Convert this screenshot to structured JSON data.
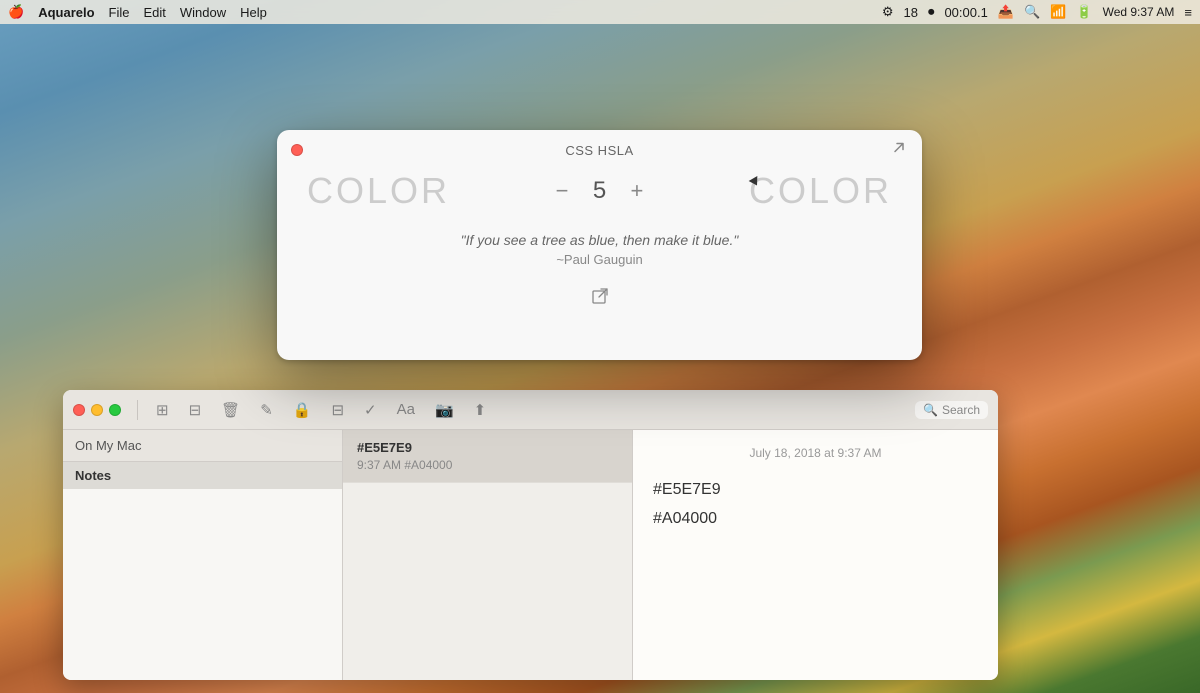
{
  "menubar": {
    "apple": "🍎",
    "app_name": "Aquarelo",
    "menus": [
      "File",
      "Edit",
      "Window",
      "Help"
    ],
    "right_icons": [
      "⚙",
      "18",
      "⏺",
      "00:00.1",
      "📤",
      "🔍",
      "📶",
      "🔋"
    ],
    "clock": "Wed 9:37 AM"
  },
  "aquarelo_window": {
    "title": "CSS HSLA",
    "traffic_color": "#ff5f56",
    "color_label_left": "COLOR",
    "color_label_right": "COLOR",
    "stepper_minus": "−",
    "stepper_value": "5",
    "stepper_plus": "+",
    "quote": "\"If you see a tree as blue, then make it blue.\"",
    "quote_author": "~Paul Gauguin",
    "link_icon": "⤢"
  },
  "notes_window": {
    "toolbar_icons": [
      "⊞",
      "⊟",
      "🗑",
      "✎",
      "🔒",
      "⊟",
      "✓",
      "Aa",
      "📷",
      "⬆"
    ],
    "search_placeholder": "Search",
    "sidebar_header": "On My Mac",
    "category": "Notes",
    "note_title": "#E5E7E9",
    "note_meta": "9:37 AM  #A04000",
    "note_date": "July 18, 2018 at 9:37 AM",
    "note_content_line1": "#E5E7E9",
    "note_content_line2": "#A04000"
  }
}
